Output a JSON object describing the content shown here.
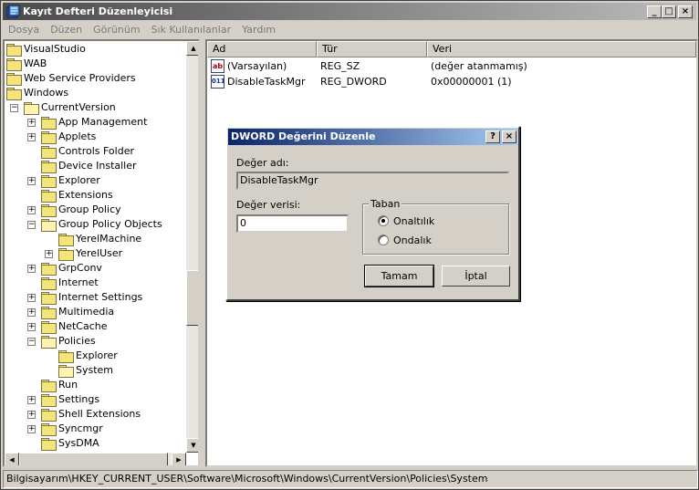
{
  "window": {
    "title": "Kayıt Defteri Düzenleyicisi",
    "minimize": "_",
    "maximize": "□",
    "close": "×"
  },
  "menu": [
    "Dosya",
    "Düzen",
    "Görünüm",
    "Sık Kullanılanlar",
    "Yardım"
  ],
  "tree": {
    "items": [
      {
        "label": "VisualStudio",
        "depth": 0
      },
      {
        "label": "WAB",
        "depth": 0
      },
      {
        "label": "Web Service Providers",
        "depth": 0
      },
      {
        "label": "Windows",
        "depth": 0
      },
      {
        "label": "CurrentVersion",
        "depth": 1,
        "expander": "−",
        "open": true
      },
      {
        "label": "App Management",
        "depth": 2,
        "expander": "+"
      },
      {
        "label": "Applets",
        "depth": 2,
        "expander": "+"
      },
      {
        "label": "Controls Folder",
        "depth": 2
      },
      {
        "label": "Device Installer",
        "depth": 2
      },
      {
        "label": "Explorer",
        "depth": 2,
        "expander": "+"
      },
      {
        "label": "Extensions",
        "depth": 2
      },
      {
        "label": "Group Policy",
        "depth": 2,
        "expander": "+"
      },
      {
        "label": "Group Policy Objects",
        "depth": 2,
        "expander": "−",
        "open": true
      },
      {
        "label": "YerelMachine",
        "depth": 3
      },
      {
        "label": "YerelUser",
        "depth": 3,
        "expander": "+"
      },
      {
        "label": "GrpConv",
        "depth": 2,
        "expander": "+"
      },
      {
        "label": "Internet",
        "depth": 2
      },
      {
        "label": "Internet Settings",
        "depth": 2,
        "expander": "+"
      },
      {
        "label": "Multimedia",
        "depth": 2,
        "expander": "+"
      },
      {
        "label": "NetCache",
        "depth": 2,
        "expander": "+"
      },
      {
        "label": "Policies",
        "depth": 2,
        "expander": "−",
        "open": true
      },
      {
        "label": "Explorer",
        "depth": 3
      },
      {
        "label": "System",
        "depth": 3,
        "open": true
      },
      {
        "label": "Run",
        "depth": 2
      },
      {
        "label": "Settings",
        "depth": 2,
        "expander": "+"
      },
      {
        "label": "Shell Extensions",
        "depth": 2,
        "expander": "+"
      },
      {
        "label": "Syncmgr",
        "depth": 2,
        "expander": "+"
      },
      {
        "label": "SysDMA",
        "depth": 2
      }
    ]
  },
  "list": {
    "columns": [
      "Ad",
      "Tür",
      "Veri"
    ],
    "rows": [
      {
        "icon": "ab",
        "name": "(Varsayılan)",
        "type": "REG_SZ",
        "data": "(değer atanmamış)"
      },
      {
        "icon": "011",
        "name": "DisableTaskMgr",
        "type": "REG_DWORD",
        "data": "0x00000001 (1)"
      }
    ]
  },
  "dialog": {
    "title": "DWORD Değerini Düzenle",
    "help": "?",
    "close": "×",
    "name_label": "Değer adı:",
    "name_value": "DisableTaskMgr",
    "data_label": "Değer verisi:",
    "data_value": "0",
    "base_label": "Taban",
    "hex_label": "Onaltılık",
    "dec_label": "Ondalık",
    "ok": "Tamam",
    "cancel": "İptal"
  },
  "status": "Bilgisayarım\\HKEY_CURRENT_USER\\Software\\Microsoft\\Windows\\CurrentVersion\\Policies\\System",
  "colors": {
    "title_gradient_start": "#4a4a4a",
    "dialog_title": "#0a246a",
    "face": "#d4d0c8"
  }
}
